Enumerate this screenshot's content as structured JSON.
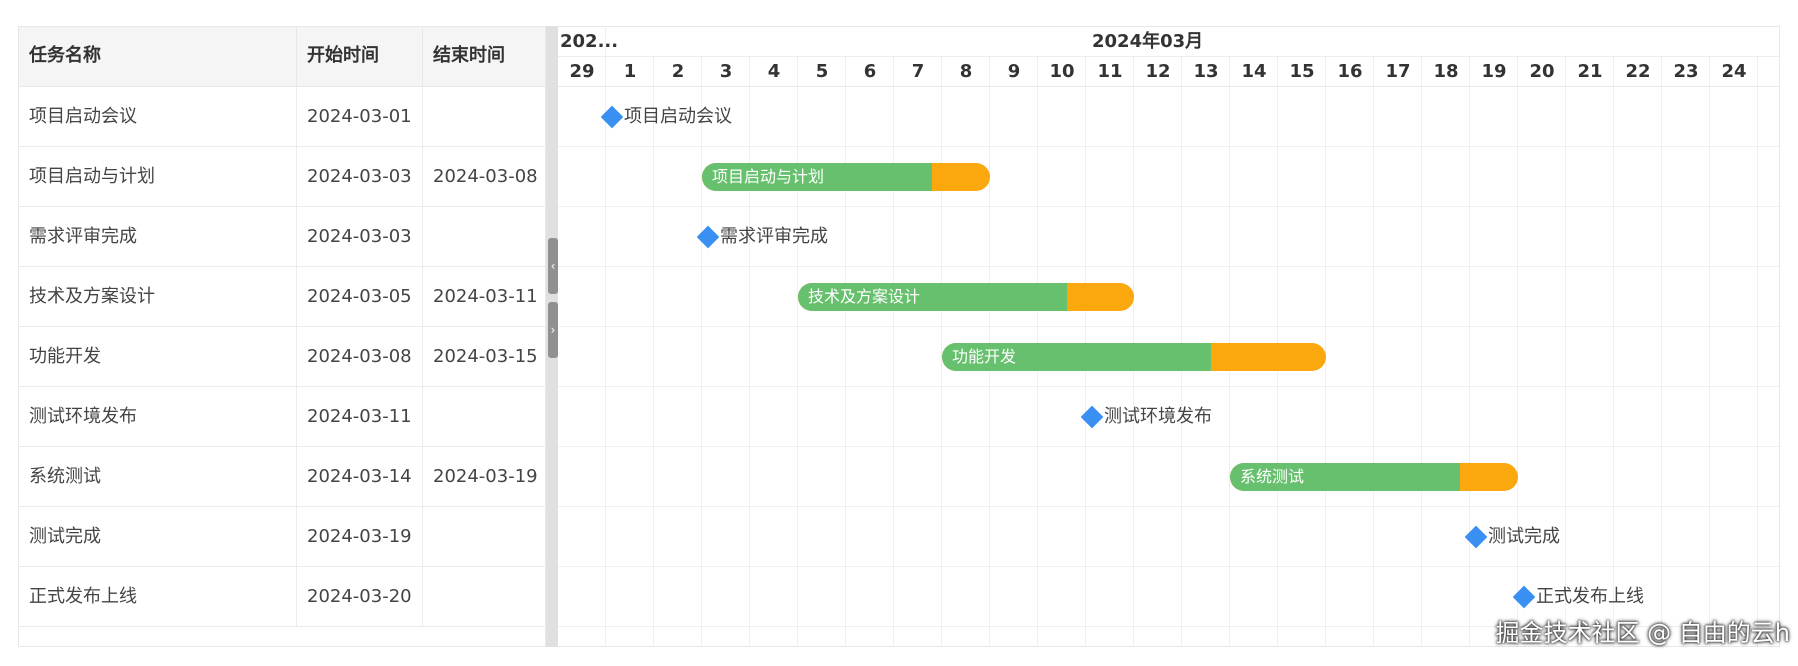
{
  "grid": {
    "headers": {
      "name": "任务名称",
      "start": "开始时间",
      "end": "结束时间"
    },
    "rows": [
      {
        "name": "项目启动会议",
        "start": "2024-03-01",
        "end": ""
      },
      {
        "name": "项目启动与计划",
        "start": "2024-03-03",
        "end": "2024-03-08"
      },
      {
        "name": "需求评审完成",
        "start": "2024-03-03",
        "end": ""
      },
      {
        "name": "技术及方案设计",
        "start": "2024-03-05",
        "end": "2024-03-11"
      },
      {
        "name": "功能开发",
        "start": "2024-03-08",
        "end": "2024-03-15"
      },
      {
        "name": "测试环境发布",
        "start": "2024-03-11",
        "end": ""
      },
      {
        "name": "系统测试",
        "start": "2024-03-14",
        "end": "2024-03-19"
      },
      {
        "name": "测试完成",
        "start": "2024-03-19",
        "end": ""
      },
      {
        "name": "正式发布上线",
        "start": "2024-03-20",
        "end": ""
      }
    ]
  },
  "splitter": {
    "collapse_glyph": "‹",
    "expand_glyph": "›"
  },
  "timeline": {
    "months": [
      "202...",
      "2024年03月"
    ],
    "days": [
      "29",
      "1",
      "2",
      "3",
      "4",
      "5",
      "6",
      "7",
      "8",
      "9",
      "10",
      "11",
      "12",
      "13",
      "14",
      "15",
      "16",
      "17",
      "18",
      "19",
      "20",
      "21",
      "22",
      "23",
      "24"
    ]
  },
  "tasks": [
    {
      "type": "milestone",
      "label": "项目启动会议",
      "start": "2024-03-01"
    },
    {
      "type": "bar",
      "label": "项目启动与计划",
      "start": "2024-03-03",
      "end": "2024-03-08",
      "progress": 0.8
    },
    {
      "type": "milestone",
      "label": "需求评审完成",
      "start": "2024-03-03"
    },
    {
      "type": "bar",
      "label": "技术及方案设计",
      "start": "2024-03-05",
      "end": "2024-03-11",
      "progress": 0.8
    },
    {
      "type": "bar",
      "label": "功能开发",
      "start": "2024-03-08",
      "end": "2024-03-15",
      "progress": 0.7
    },
    {
      "type": "milestone",
      "label": "测试环境发布",
      "start": "2024-03-11"
    },
    {
      "type": "bar",
      "label": "系统测试",
      "start": "2024-03-14",
      "end": "2024-03-19",
      "progress": 0.8
    },
    {
      "type": "milestone",
      "label": "测试完成",
      "start": "2024-03-19"
    },
    {
      "type": "milestone",
      "label": "正式发布上线",
      "start": "2024-03-20"
    }
  ],
  "colors": {
    "bar_progress": "#67c06d",
    "bar_remaining": "#fba80e",
    "milestone": "#3a8ff2"
  },
  "watermark": "掘金技术社区 @ 自由的云h"
}
